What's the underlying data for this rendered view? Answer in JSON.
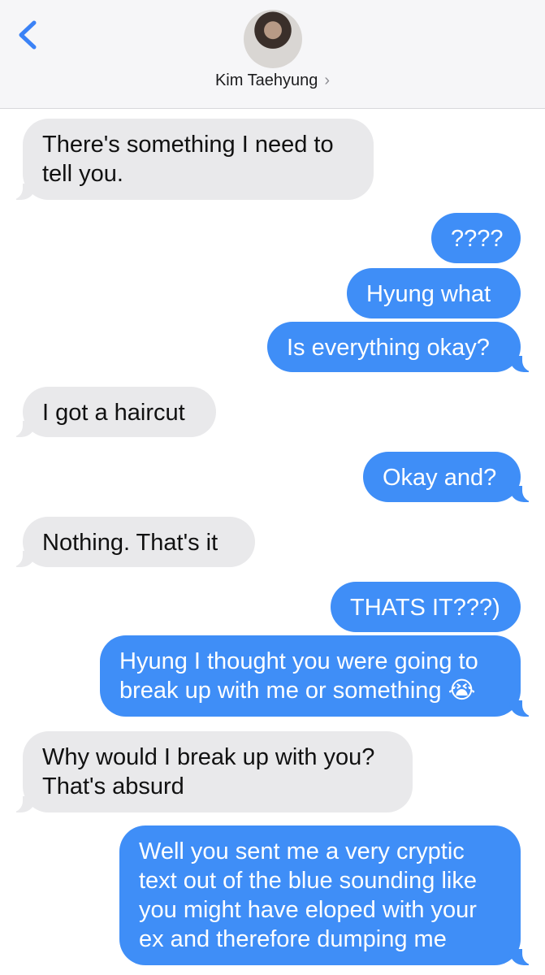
{
  "header": {
    "contact_name": "Kim Taehyung",
    "chevron": "›"
  },
  "messages": [
    {
      "dir": "in",
      "text": "There's something I need to\ntell you."
    },
    {
      "dir": "out",
      "text": "????"
    },
    {
      "dir": "out",
      "text": "Hyung what"
    },
    {
      "dir": "out",
      "text": "Is everything okay?"
    },
    {
      "dir": "in",
      "text": "I got a haircut"
    },
    {
      "dir": "out",
      "text": "Okay and?"
    },
    {
      "dir": "in",
      "text": "Nothing. That's it"
    },
    {
      "dir": "out",
      "text": "THATS IT???)"
    },
    {
      "dir": "out",
      "text": "Hyung I thought you were going to\nbreak up with me or something 😭"
    },
    {
      "dir": "in",
      "text": "Why would I break up with you?\nThat's absurd"
    },
    {
      "dir": "out",
      "text": "Well you sent me a very cryptic\ntext out of the blue sounding like\nyou might have eloped with your\nex and therefore dumping me"
    }
  ],
  "colors": {
    "outgoing": "#3f8ef7",
    "incoming": "#e9e9eb",
    "accent": "#3b82f6"
  },
  "icons": {
    "back": "chevron-left-icon",
    "avatar": "contact-avatar"
  }
}
